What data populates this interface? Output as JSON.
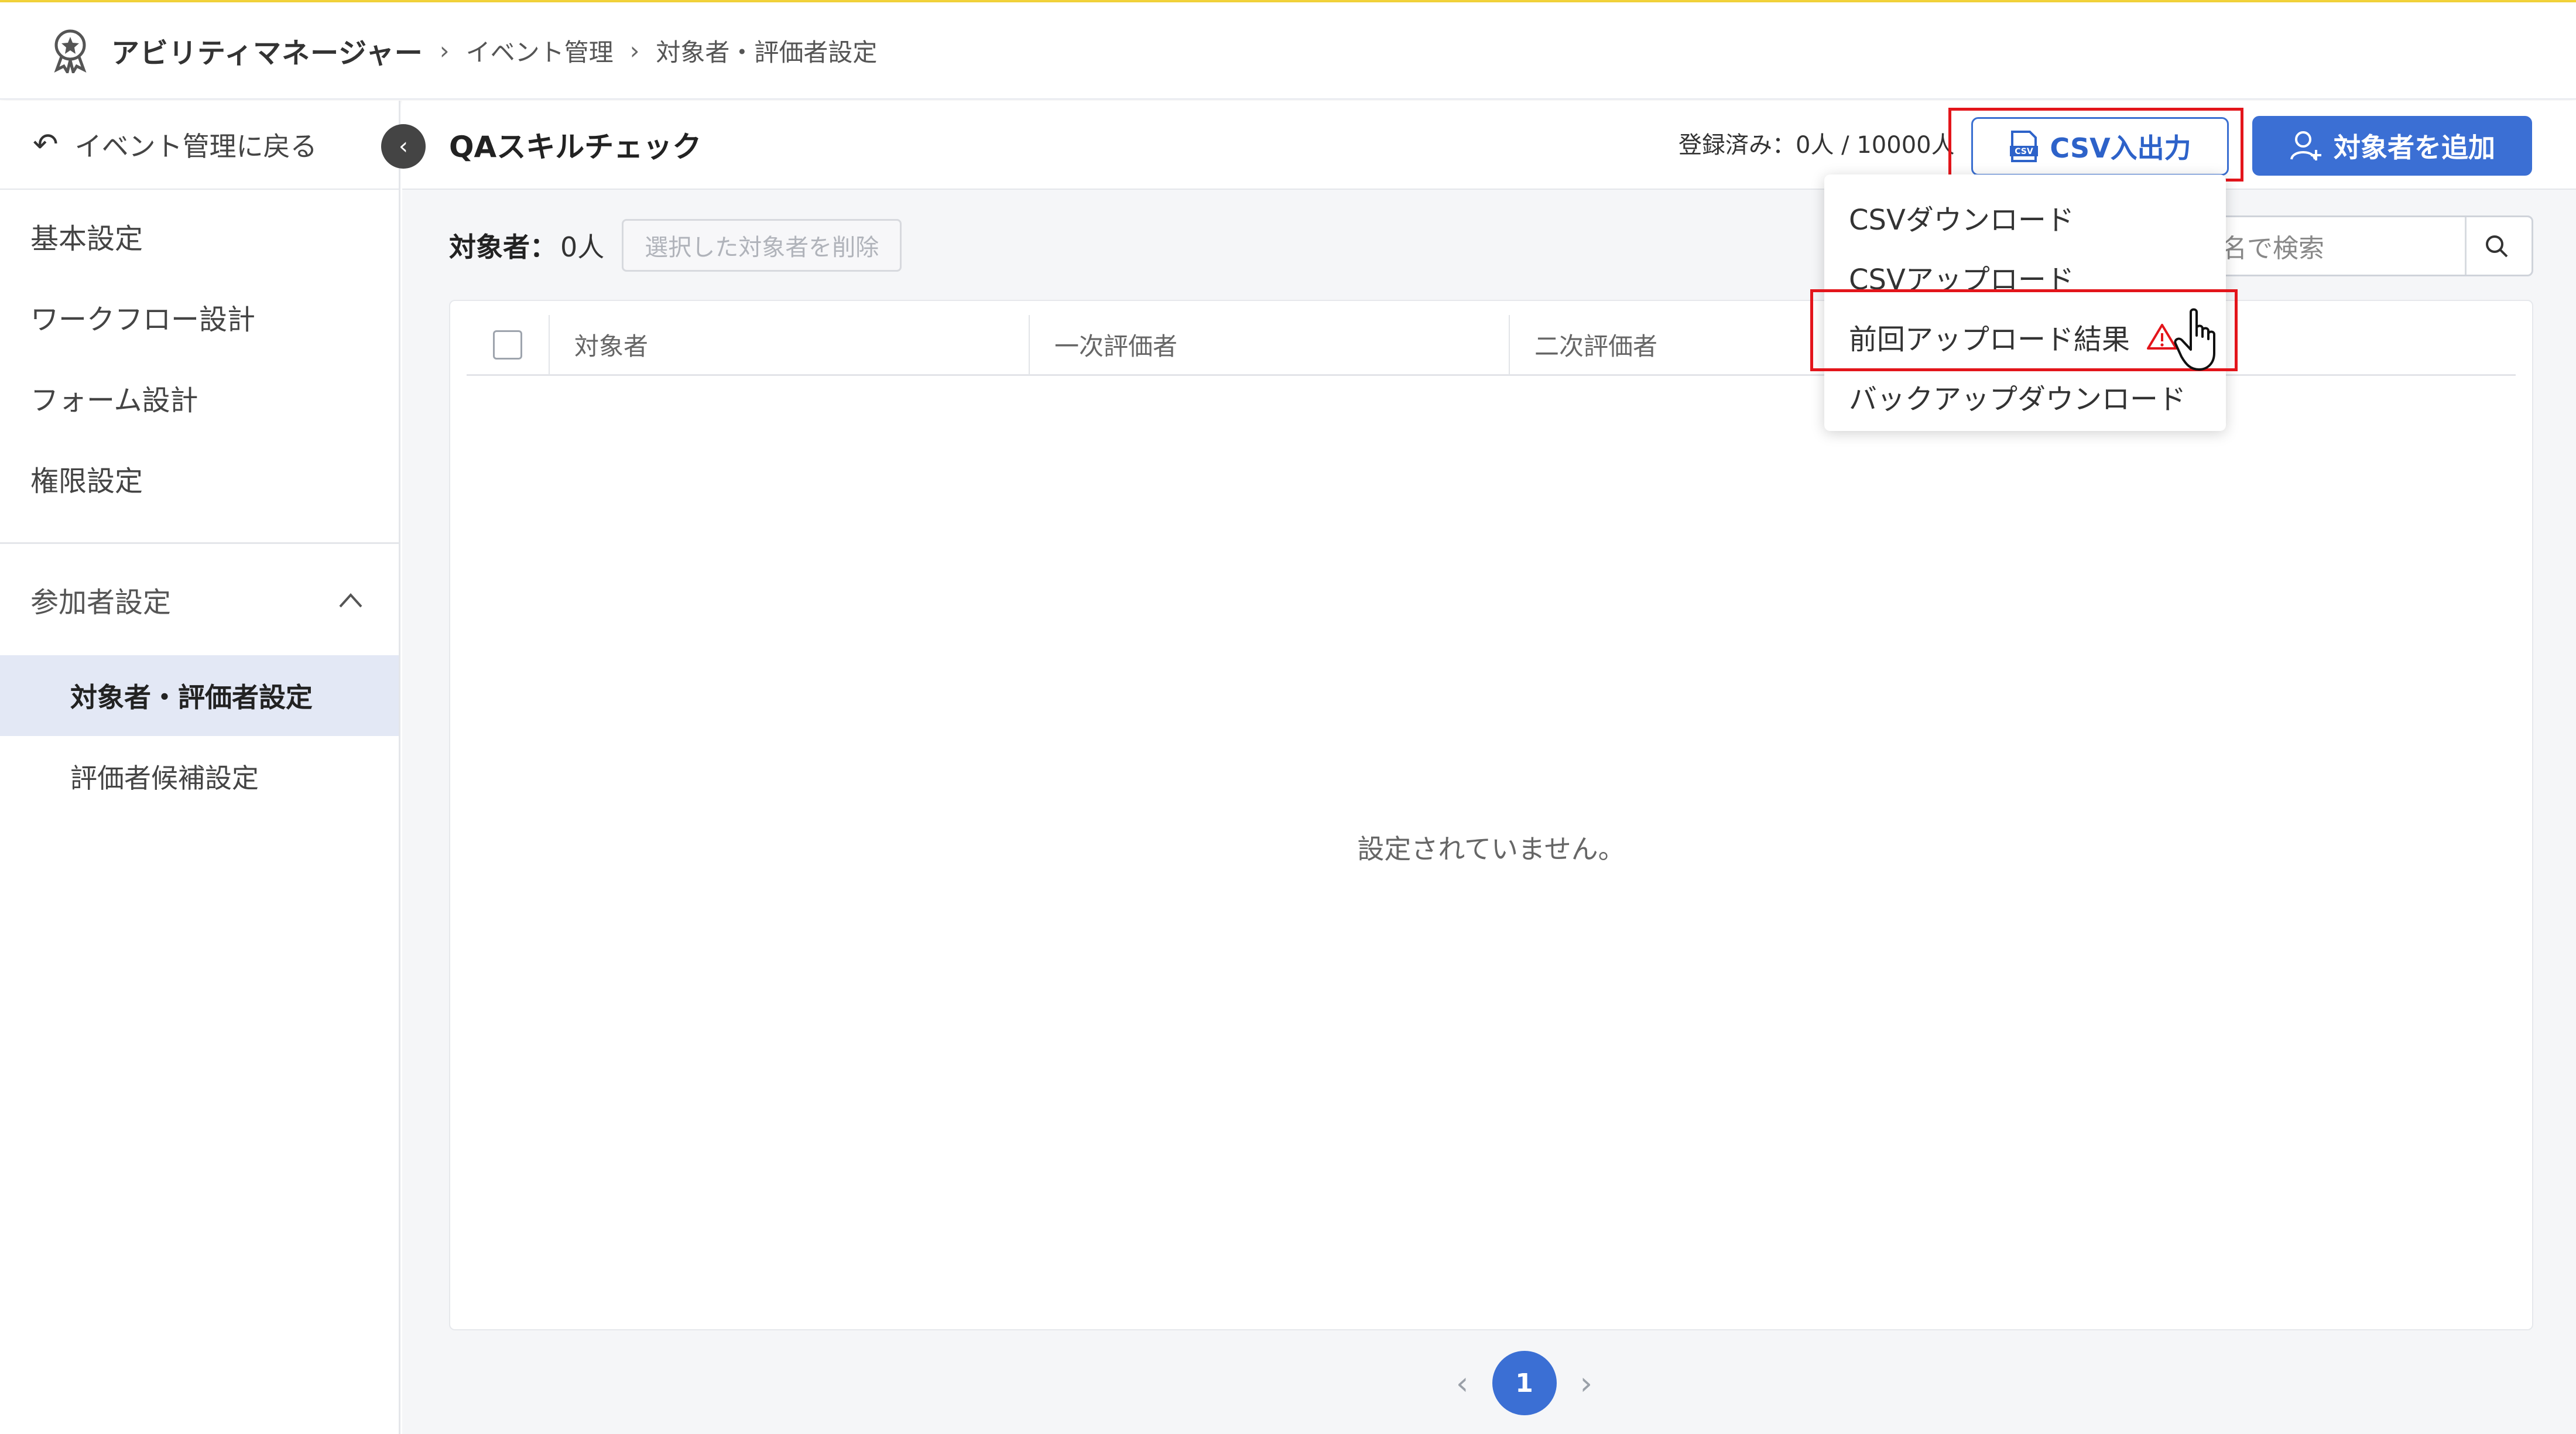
{
  "header": {
    "app_title": "アビリティマネージャー",
    "breadcrumbs": [
      "イベント管理",
      "対象者・評価者設定"
    ]
  },
  "sidebar": {
    "back_label": "イベント管理に戻る",
    "items": [
      "基本設定",
      "ワークフロー設計",
      "フォーム設計",
      "権限設定"
    ],
    "group_label": "参加者設定",
    "sub_items": [
      "対象者・評価者設定",
      "評価者候補設定"
    ]
  },
  "toolbar": {
    "event_title": "QAスキルチェック",
    "registered": "登録済み：0人 / 10000人",
    "csv_button": "CSV入出力",
    "add_button": "対象者を追加"
  },
  "subbar": {
    "label": "対象者：",
    "count": "0人",
    "delete_button": "選択した対象者を削除",
    "search_visible_text": "者名で検索"
  },
  "table": {
    "columns": [
      "対象者",
      "一次評価者",
      "二次評価者"
    ],
    "empty_text": "設定されていません。"
  },
  "pagination": {
    "current_page": "1"
  },
  "dropdown": {
    "items": [
      "CSVダウンロード",
      "CSVアップロード",
      "前回アップロード結果",
      "バックアップダウンロード"
    ]
  },
  "colors": {
    "accent": "#3b6fd4",
    "highlight": "#e3151b",
    "warning": "#e3151b",
    "top_line": "#f2d23a"
  }
}
